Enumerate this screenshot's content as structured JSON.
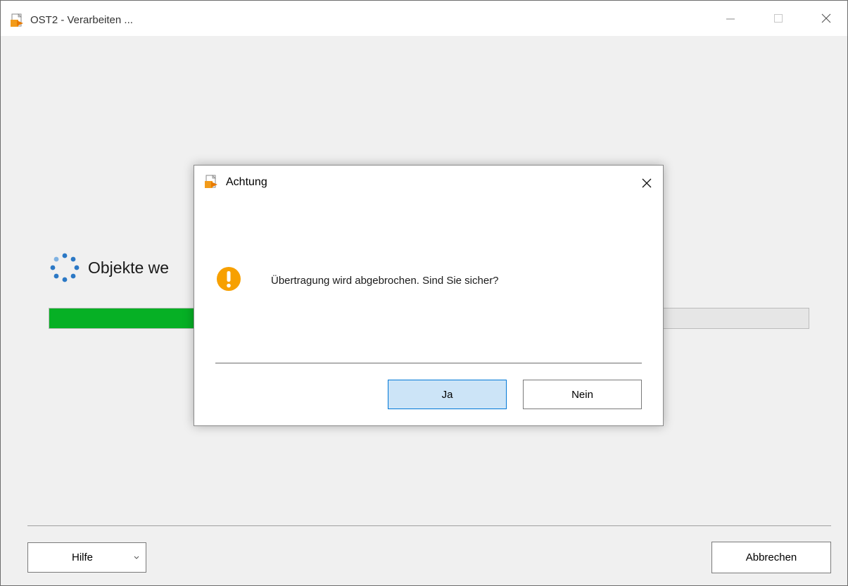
{
  "window": {
    "title": "OST2 - Verarbeiten ..."
  },
  "main": {
    "status_text": "Objekte we",
    "progress": 0.19
  },
  "footer": {
    "help_label": "Hilfe",
    "cancel_label": "Abbrechen"
  },
  "dialog": {
    "title": "Achtung",
    "message": "Übertragung wird abgebrochen. Sind Sie sicher?",
    "yes_label": "Ja",
    "no_label": "Nein"
  },
  "icons": {
    "app": "app-document-icon",
    "warning": "warning-icon",
    "spinner": "spinner-icon"
  },
  "colors": {
    "progress": "#06b025",
    "warning": "#f7a000",
    "spinner": "#2b78c5",
    "accent": "#0078d7"
  }
}
